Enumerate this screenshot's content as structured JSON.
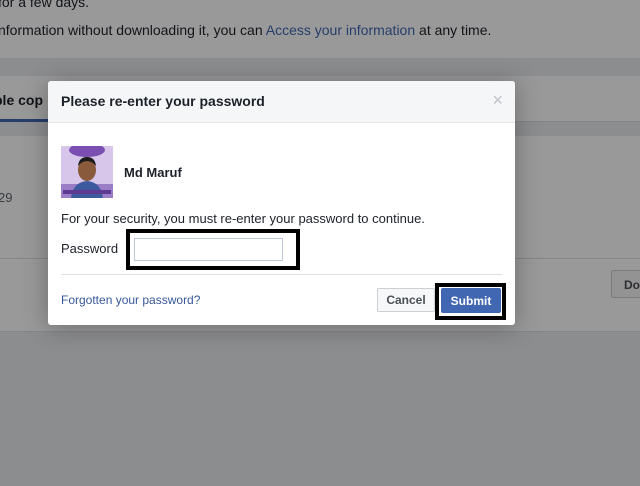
{
  "background": {
    "line1": "for a few days.",
    "line2_prefix": "nformation without downloading it, you can ",
    "line2_link": "Access your information",
    "line2_suffix": " at any time.",
    "tab_label": "ble cop",
    "row_number": "29",
    "right_button_label": "Do"
  },
  "dialog": {
    "title": "Please re-enter your password",
    "close_symbol": "×",
    "user_name": "Md Maruf",
    "security_text": "For your security, you must re-enter your password to continue.",
    "password_label": "Password",
    "password_value": "",
    "forgot_link": "Forgotten your password?",
    "cancel_label": "Cancel",
    "submit_label": "Submit"
  },
  "colors": {
    "accent": "#4267b2",
    "link": "#365899",
    "highlight_box": "#000000"
  }
}
